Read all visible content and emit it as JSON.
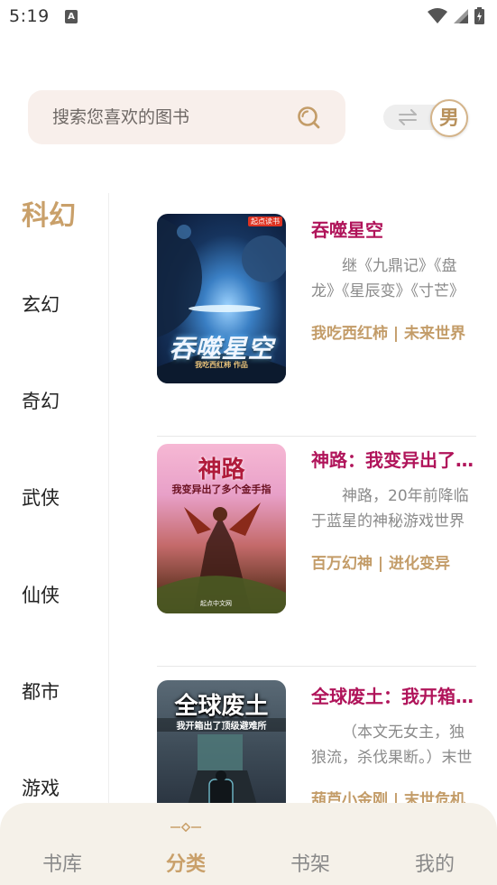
{
  "status_bar": {
    "time": "5:19",
    "notif_glyph": "A"
  },
  "search": {
    "placeholder": "搜索您喜欢的图书"
  },
  "gender_toggle": {
    "label": "男"
  },
  "categories": [
    {
      "label": "科幻",
      "active": true
    },
    {
      "label": "玄幻"
    },
    {
      "label": "奇幻"
    },
    {
      "label": "武侠"
    },
    {
      "label": "仙侠"
    },
    {
      "label": "都市"
    },
    {
      "label": "游戏"
    }
  ],
  "books": [
    {
      "title": "吞噬星空",
      "description": "继《九鼎记》《盘龙》《星辰变》《寸芒》",
      "tags": "我吃西红柿 | 未来世界",
      "cover": {
        "title": "吞噬星空",
        "author": "我吃西红柿 作品",
        "publisher": "起点读书"
      }
    },
    {
      "title": "神路：我变异出了多个金手指",
      "description": "神路，20年前降临于蓝星的神秘游戏世界",
      "tags": "百万幻神 | 进化变异",
      "cover": {
        "title": "神路",
        "subtitle": "我变异出了多个金手指",
        "publisher": "起点中文网"
      }
    },
    {
      "title": "全球废土：我开箱出了顶级避难所",
      "description": "（本文无女主，独狼流，杀伐果断。）末世",
      "tags": "葫芦小金刚 | 末世危机",
      "cover": {
        "title": "全球废土",
        "subtitle": "我开箱出了顶级避难所"
      }
    }
  ],
  "bottom_nav": {
    "tabs": [
      {
        "label": "书库"
      },
      {
        "label": "分类",
        "active": true
      },
      {
        "label": "书架"
      },
      {
        "label": "我的"
      }
    ]
  },
  "colors": {
    "accent": "#c9a06a",
    "title": "#b0145a",
    "search_bg": "#f8efeb",
    "nav_bg": "#f5f1e9"
  }
}
